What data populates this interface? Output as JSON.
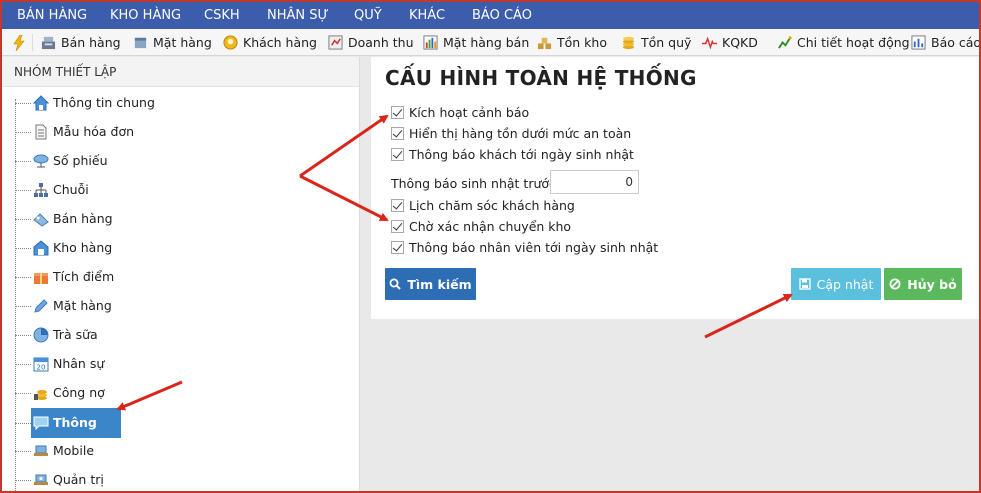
{
  "top_menu": [
    "BÁN HÀNG",
    "KHO HÀNG",
    "CSKH",
    "NHÂN SỰ",
    "QUỸ",
    "KHÁC",
    "BÁO CÁO"
  ],
  "toolbar": [
    "Bán hàng",
    "Mặt hàng",
    "Khách hàng",
    "Doanh thu",
    "Mặt hàng bán",
    "Tồn kho",
    "Tồn quỹ",
    "KQKD",
    "Chi tiết hoạt động",
    "Báo cáo"
  ],
  "sidebar": {
    "header": "NHÓM THIẾT LẬP",
    "items": [
      "Thông tin chung",
      "Mẫu hóa đơn",
      "Số phiếu",
      "Chuỗi",
      "Bán hàng",
      "Kho hàng",
      "Tích điểm",
      "Mặt hàng",
      "Trà sữa",
      "Nhân sự",
      "Công nợ",
      "Thông báo",
      "Mobile",
      "Quản trị"
    ],
    "active": "Thông báo"
  },
  "main": {
    "title": "CẤU HÌNH TOÀN HỆ THỐNG",
    "checks": [
      "Kích hoạt cảnh báo",
      "Hiển thị hàng tồn dưới mức an toàn",
      "Thông báo khách tới ngày sinh nhật"
    ],
    "bday_label": "Thông báo sinh nhật trước",
    "bday_value": "0",
    "checks2": [
      "Lịch chăm sóc khách hàng",
      "Chờ xác nhận chuyển kho",
      "Thông báo nhân viên tới ngày sinh nhật"
    ],
    "search_label": "Tìm kiếm",
    "update_label": "Cập nhật",
    "cancel_label": "Hủy bỏ"
  },
  "colors": {
    "menu": "#3b5dab",
    "active_item": "#3a86c8",
    "search": "#2d6db3",
    "update": "#5bc0de",
    "cancel": "#5cb85c",
    "arrow": "#d9261c"
  },
  "icons": {
    "toolbar_lead": "lightning-icon",
    "search": "search-icon",
    "update": "save-icon",
    "cancel": "ban-icon"
  }
}
